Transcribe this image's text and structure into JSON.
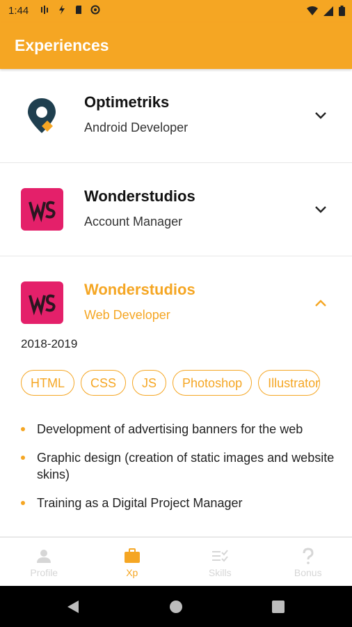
{
  "status_bar": {
    "time": "1:44"
  },
  "app_bar": {
    "title": "Experiences"
  },
  "experiences": [
    {
      "company": "Optimetriks",
      "role": "Android Developer",
      "logo": "map-pin-logo",
      "expanded": false
    },
    {
      "company": "Wonderstudios",
      "role": "Account Manager",
      "logo": "ws-logo",
      "expanded": false
    },
    {
      "company": "Wonderstudios",
      "role": "Web Developer",
      "logo": "ws-logo",
      "expanded": true,
      "dates": "2018-2019",
      "skills": [
        "HTML",
        "CSS",
        "JS",
        "Photoshop",
        "Illustrator"
      ],
      "tasks": [
        "Development of advertising banners for the web",
        "Graphic design (creation of static images and website skins)",
        "Training as a Digital Project Manager"
      ]
    }
  ],
  "bottom_nav": [
    {
      "label": "Profile",
      "icon": "person-icon",
      "active": false
    },
    {
      "label": "Xp",
      "icon": "briefcase-icon",
      "active": true
    },
    {
      "label": "Skills",
      "icon": "checklist-icon",
      "active": false
    },
    {
      "label": "Bonus",
      "icon": "question-icon",
      "active": false
    }
  ],
  "colors": {
    "accent": "#f5a623",
    "ws_logo": "#e4206a",
    "optimetriks_dark": "#1f3f4f"
  }
}
